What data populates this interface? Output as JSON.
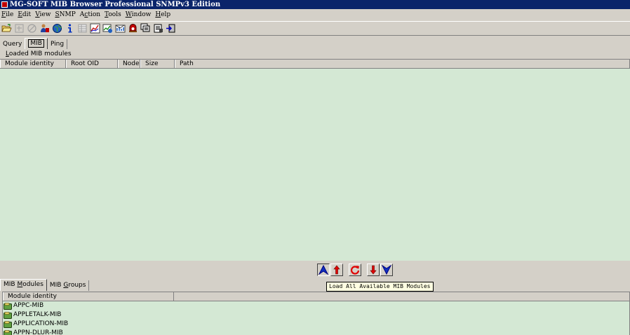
{
  "window": {
    "title": "MG-SOFT MIB Browser Professional SNMPv3 Edition"
  },
  "menubar": [
    {
      "key": "F",
      "rest": "ile"
    },
    {
      "key": "E",
      "rest": "dit"
    },
    {
      "key": "V",
      "rest": "iew"
    },
    {
      "key": "S",
      "rest": "NMP"
    },
    {
      "pre": "A",
      "key": "c",
      "rest": "tion"
    },
    {
      "key": "T",
      "rest": "ools"
    },
    {
      "key": "W",
      "rest": "indow"
    },
    {
      "key": "H",
      "rest": "elp"
    }
  ],
  "toolbar_icons": [
    "open-folder-icon",
    "disabled-tool-icon",
    "disabled-stop-icon",
    "contact-icon",
    "globe-icon",
    "info-icon",
    "table-icon",
    "chart-icon",
    "graph-icon",
    "trap-icon",
    "ringer-icon",
    "stack-icon",
    "notepad-icon",
    "exit-icon"
  ],
  "tabs": {
    "query": "Query",
    "mib": "MIB",
    "ping": "Ping"
  },
  "loaded_modules": {
    "label_key": "L",
    "label_rest": "oaded MIB modules",
    "columns": [
      "Module identity",
      "Root OID",
      "Nodes",
      "Size",
      "Path"
    ],
    "rows": []
  },
  "arrow_buttons": [
    "load-all-icon",
    "load-selected-icon",
    "refresh-icon",
    "unload-selected-icon",
    "unload-all-icon"
  ],
  "tooltip": "Load All Available MIB Modules",
  "bottom_tabs": {
    "modules_pre": "MIB ",
    "modules_key": "M",
    "modules_rest": "odules",
    "groups_pre": "MIB ",
    "groups_key": "G",
    "groups_rest": "roups"
  },
  "available_modules": {
    "column": "Module identity",
    "rows": [
      "APPC-MIB",
      "APPLETALK-MIB",
      "APPLICATION-MIB",
      "APPN-DLUR-MIB"
    ]
  },
  "colors": {
    "titlebar": "#0a246a",
    "list_background": "#d4e8d4",
    "face": "#d4d0c8",
    "tooltip": "#ffffe1"
  }
}
